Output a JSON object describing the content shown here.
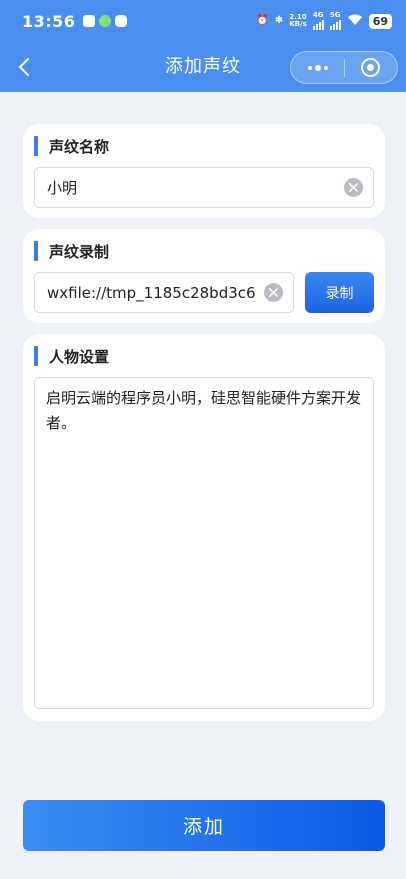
{
  "status_bar": {
    "time": "13:56",
    "net_speed_value": "2.10",
    "net_speed_unit": "KB/s",
    "network_4g": "4G",
    "network_5g": "5G",
    "battery": "69"
  },
  "nav": {
    "title": "添加声纹"
  },
  "name_section": {
    "title": "声纹名称",
    "value": "小明"
  },
  "record_section": {
    "title": "声纹录制",
    "file_value": "wxfile://tmp_1185c28bd3c6",
    "record_button": "录制"
  },
  "persona_section": {
    "title": "人物设置",
    "value": "启明云端的程序员小明，硅思智能硬件方案开发者。"
  },
  "footer": {
    "add_button": "添加"
  },
  "colors": {
    "primary": "#4a8ff0",
    "accent_button": "#1c64e4",
    "background": "#eef2f6"
  }
}
